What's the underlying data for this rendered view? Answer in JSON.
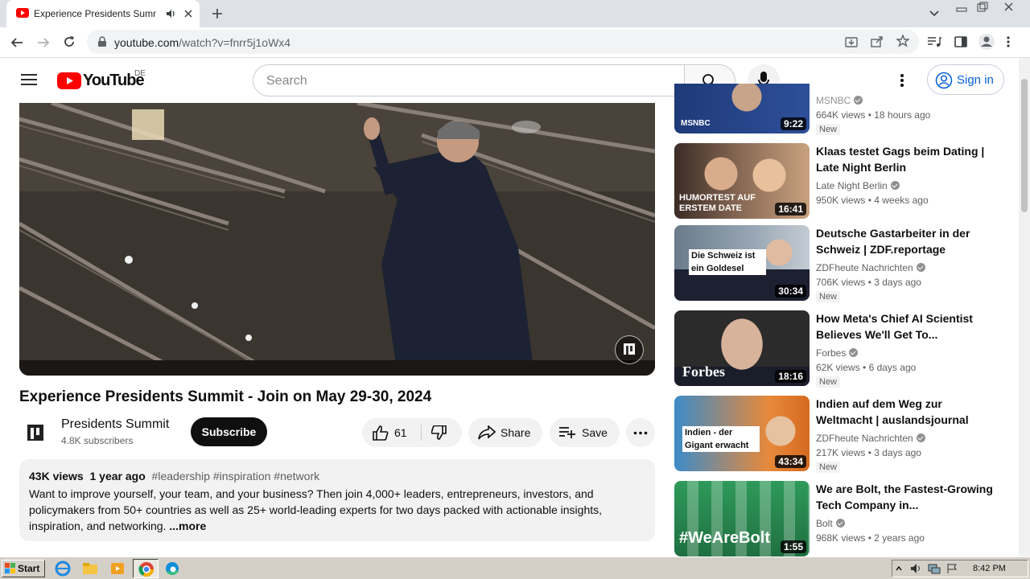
{
  "browser": {
    "tab_title": "Experience Presidents Summit -",
    "url_host": "youtube.com",
    "url_path": "/watch?v=fnrr5j1oWx4",
    "new_tab_label": "+"
  },
  "header": {
    "logo_text": "YouTube",
    "region": "DE",
    "search_placeholder": "Search",
    "signin_label": "Sign in"
  },
  "video": {
    "title": "Experience Presidents Summit - Join on May 29-30, 2024",
    "channel": "Presidents Summit",
    "subscribers": "4.8K subscribers",
    "subscribe_label": "Subscribe",
    "likes": "61",
    "share_label": "Share",
    "save_label": "Save",
    "views": "43K views",
    "age": "1 year ago",
    "tags": "#leadership #inspiration #network",
    "description": "Want to improve yourself, your team, and your business? Then join 4,000+ leaders, entrepreneurs, investors, and policymakers from 50+ countries as well as 25+ world-leading experts for two days packed with actionable insights, inspiration, and networking.",
    "more_label": "...more"
  },
  "recommendations": [
    {
      "title": "",
      "channel": "MSNBC",
      "views": "664K views",
      "age": "18 hours ago",
      "badge": "New",
      "duration": "9:22",
      "thumb_text": "MSNBC"
    },
    {
      "title": "Klaas testet Gags beim Dating | Late Night Berlin",
      "channel": "Late Night Berlin",
      "views": "950K views",
      "age": "4 weeks ago",
      "badge": "",
      "duration": "16:41",
      "thumb_text": "HUMORTEST AUF ERSTEM DATE"
    },
    {
      "title": "Deutsche Gastarbeiter in der Schweiz | ZDF.reportage",
      "channel": "ZDFheute Nachrichten",
      "views": "706K views",
      "age": "3 days ago",
      "badge": "New",
      "duration": "30:34",
      "thumb_text": "Die Schweiz ist ein Goldesel"
    },
    {
      "title": "How Meta's Chief AI Scientist Believes We'll Get To...",
      "channel": "Forbes",
      "views": "62K views",
      "age": "6 days ago",
      "badge": "New",
      "duration": "18:16",
      "thumb_text": "Forbes"
    },
    {
      "title": "Indien auf dem Weg zur Weltmacht | auslandsjournal",
      "channel": "ZDFheute Nachrichten",
      "views": "217K views",
      "age": "3 days ago",
      "badge": "New",
      "duration": "43:34",
      "thumb_text": "Indien - der Gigant erwacht"
    },
    {
      "title": "We are Bolt, the Fastest-Growing Tech Company in...",
      "channel": "Bolt",
      "views": "968K views",
      "age": "2 years ago",
      "badge": "",
      "duration": "1:55",
      "thumb_text": "#WeAreBolt"
    }
  ],
  "taskbar": {
    "start_label": "Start",
    "clock": "8:42 PM"
  },
  "colors": {
    "youtube_red": "#ff0000",
    "link_blue": "#065fd4",
    "chrome_tabstrip": "#dee1e6"
  }
}
